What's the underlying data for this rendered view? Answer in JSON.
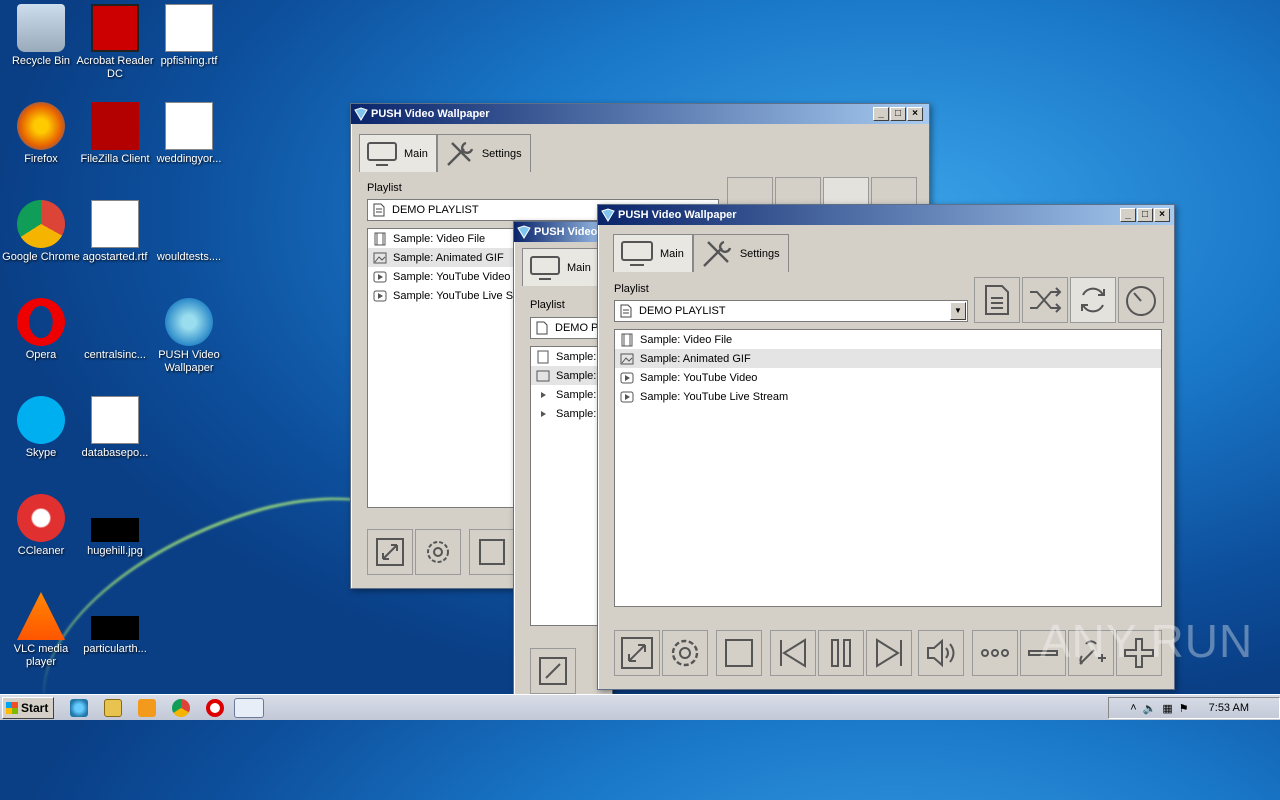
{
  "desktop": {
    "icons": [
      {
        "label": "Recycle Bin"
      },
      {
        "label": "Acrobat Reader DC"
      },
      {
        "label": "ppfishing.rtf"
      },
      {
        "label": "Firefox"
      },
      {
        "label": "FileZilla Client"
      },
      {
        "label": "weddingyor..."
      },
      {
        "label": "Google Chrome"
      },
      {
        "label": "agostarted.rtf"
      },
      {
        "label": "wouldtests...."
      },
      {
        "label": "Opera"
      },
      {
        "label": "centralsinc..."
      },
      {
        "label": "PUSH Video Wallpaper"
      },
      {
        "label": "Skype"
      },
      {
        "label": "databasepo..."
      },
      {
        "label": "CCleaner"
      },
      {
        "label": "hugehill.jpg"
      },
      {
        "label": "VLC media player"
      },
      {
        "label": "particularth..."
      }
    ]
  },
  "app": {
    "title": "PUSH Video Wallpaper",
    "tabs": {
      "main": "Main",
      "settings": "Settings"
    },
    "playlist_label": "Playlist",
    "playlist_value": "DEMO PLAYLIST",
    "items": [
      {
        "label": "Sample: Video File",
        "type": "video"
      },
      {
        "label": "Sample: Animated GIF",
        "type": "gif"
      },
      {
        "label": "Sample: YouTube Video",
        "type": "youtube"
      },
      {
        "label": "Sample: YouTube Live Stream",
        "type": "youtube"
      }
    ],
    "selected_index": 1,
    "title_controls": {
      "min": "_",
      "max": "□",
      "close": "×"
    }
  },
  "back_window": {
    "items": [
      "Sample: Video File",
      "Sample: Animated GIF",
      "Sample: YouTube Video",
      "Sample: YouTube Live St"
    ]
  },
  "mid_window": {
    "title": "PUSH Video",
    "playlist_value": "DEMO PL",
    "items": [
      "Sample:",
      "Sample:",
      "Sample:",
      "Sample:"
    ]
  },
  "taskbar": {
    "start": "Start",
    "time": "7:53 AM"
  },
  "watermark": "ANY RUN"
}
